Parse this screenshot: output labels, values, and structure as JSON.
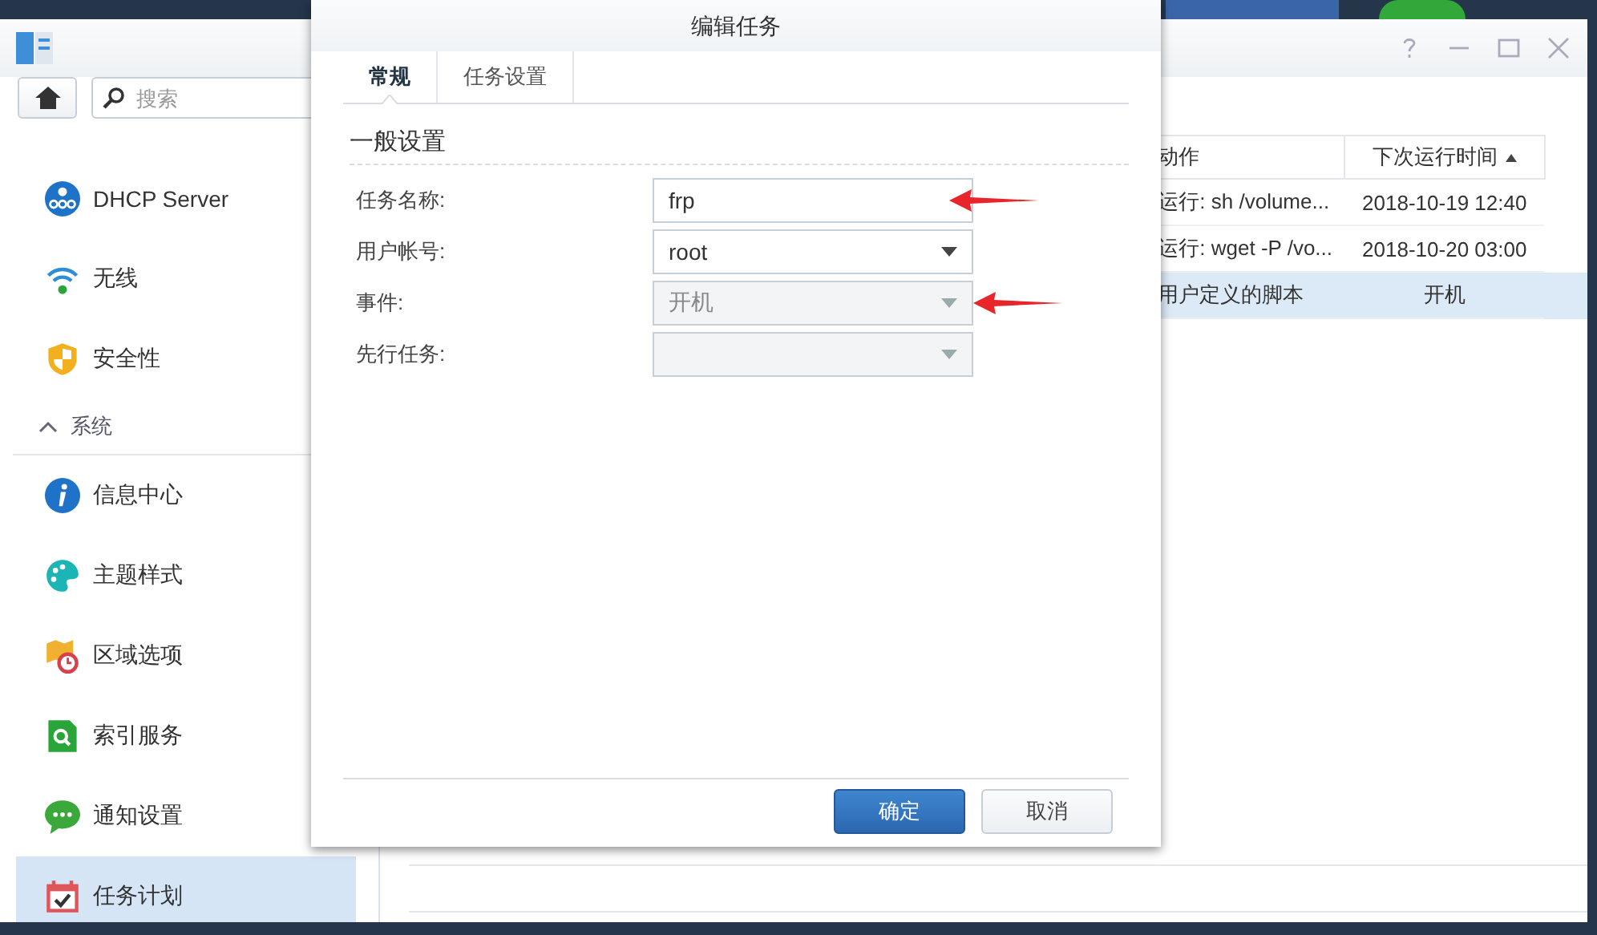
{
  "sidebar": {
    "search": {
      "placeholder": "搜索"
    },
    "items": [
      {
        "kind": "item",
        "label": "DHCP Server",
        "selected": false
      },
      {
        "kind": "item",
        "label": "无线",
        "selected": false
      },
      {
        "kind": "item",
        "label": "安全性",
        "selected": false
      },
      {
        "kind": "section",
        "label": "系统",
        "expanded": true
      },
      {
        "kind": "item",
        "label": "信息中心",
        "selected": false
      },
      {
        "kind": "item",
        "label": "主题样式",
        "selected": false
      },
      {
        "kind": "item",
        "label": "区域选项",
        "selected": false
      },
      {
        "kind": "item",
        "label": "索引服务",
        "selected": false
      },
      {
        "kind": "item",
        "label": "通知设置",
        "selected": false
      },
      {
        "kind": "item",
        "label": "任务计划",
        "selected": true
      }
    ]
  },
  "table": {
    "columns": [
      {
        "label": "动作",
        "sorted": false
      },
      {
        "label": "下次运行时间",
        "sorted": true
      }
    ],
    "rows": [
      {
        "cells": [
          "运行: sh /volume...",
          "2018-10-19 12:40"
        ],
        "selected": false
      },
      {
        "cells": [
          "运行: wget -P /vo...",
          "2018-10-20 03:00"
        ],
        "selected": false
      },
      {
        "cells": [
          "用户定义的脚本",
          "开机"
        ],
        "selected": true
      }
    ]
  },
  "dialog": {
    "title": "编辑任务",
    "tabs": [
      {
        "label": "常规",
        "selected": true
      },
      {
        "label": "任务设置",
        "selected": false
      }
    ],
    "section": "一般设置",
    "fields": [
      {
        "kind": "text",
        "label": "任务名称:",
        "value": "frp",
        "disabled": false,
        "marked": true
      },
      {
        "kind": "select",
        "label": "用户帐号:",
        "value": "root",
        "disabled": false,
        "marked": false
      },
      {
        "kind": "select",
        "label": "事件:",
        "value": "开机",
        "disabled": true,
        "marked": true
      },
      {
        "kind": "select",
        "label": "先行任务:",
        "disabled": true,
        "marked": false
      }
    ],
    "buttons": [
      {
        "label": "确定",
        "kind": "primary"
      },
      {
        "label": "取消",
        "kind": "default"
      }
    ]
  }
}
